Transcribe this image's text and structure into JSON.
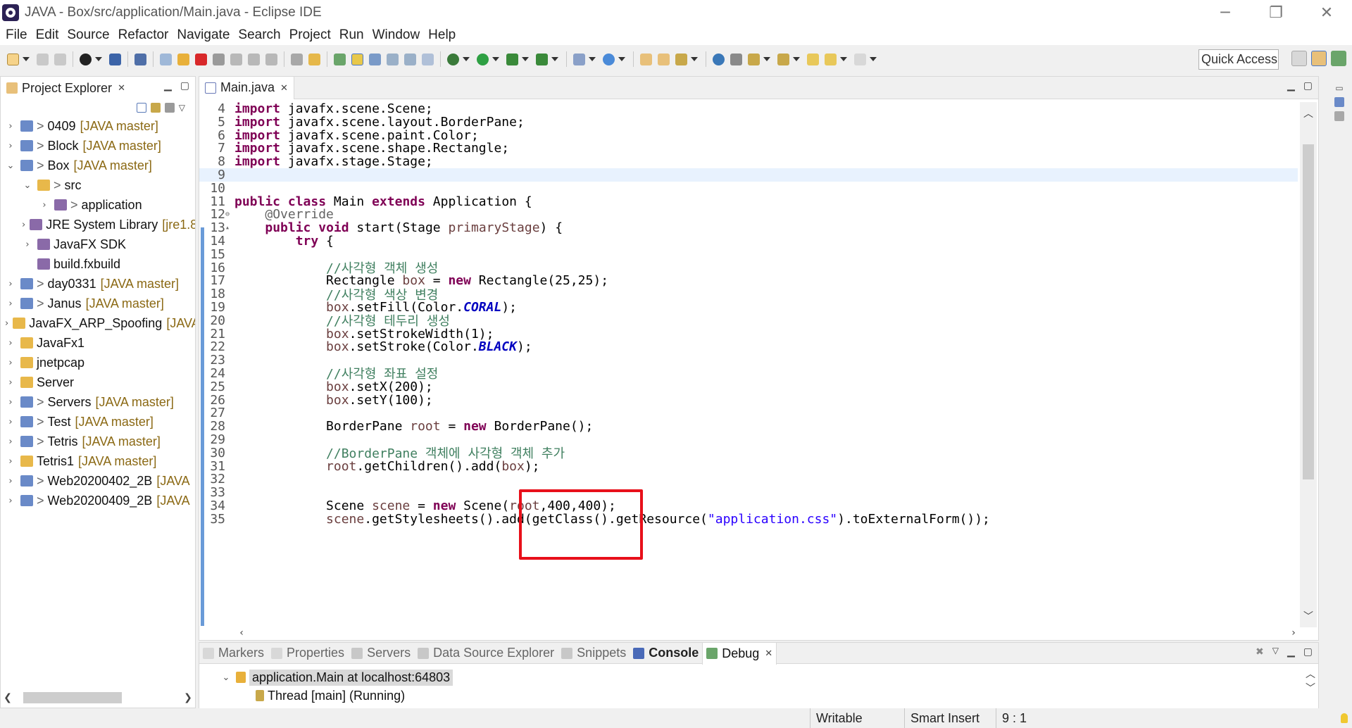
{
  "window": {
    "title": "JAVA - Box/src/application/Main.java - Eclipse IDE",
    "controls": [
      "─",
      "❐",
      "✕"
    ]
  },
  "menu": [
    "File",
    "Edit",
    "Source",
    "Refactor",
    "Navigate",
    "Search",
    "Project",
    "Run",
    "Window",
    "Help"
  ],
  "toolbar": {
    "quick_access_placeholder": "Quick Access"
  },
  "project_explorer": {
    "title": "Project Explorer",
    "items": [
      {
        "label": "0409",
        "deco": "[JAVA master]",
        "prefix": ">",
        "twisty": "›",
        "level": 0
      },
      {
        "label": "Block",
        "deco": "[JAVA master]",
        "prefix": ">",
        "twisty": "›",
        "level": 0
      },
      {
        "label": "Box",
        "deco": "[JAVA master]",
        "prefix": ">",
        "twisty": "⌄",
        "level": 0
      },
      {
        "label": "src",
        "deco": "",
        "prefix": ">",
        "twisty": "⌄",
        "level": 1
      },
      {
        "label": "application",
        "deco": "",
        "prefix": ">",
        "twisty": "›",
        "level": 2
      },
      {
        "label": "JRE System Library",
        "deco": "[jre1.8",
        "prefix": "",
        "twisty": "›",
        "level": 1
      },
      {
        "label": "JavaFX SDK",
        "deco": "",
        "prefix": "",
        "twisty": "›",
        "level": 1
      },
      {
        "label": "build.fxbuild",
        "deco": "",
        "prefix": "",
        "twisty": "",
        "level": 1
      },
      {
        "label": "day0331",
        "deco": "[JAVA master]",
        "prefix": ">",
        "twisty": "›",
        "level": 0
      },
      {
        "label": "Janus",
        "deco": "[JAVA master]",
        "prefix": ">",
        "twisty": "›",
        "level": 0
      },
      {
        "label": "JavaFX_ARP_Spoofing",
        "deco": "[JAVA",
        "prefix": "",
        "twisty": "›",
        "level": 0
      },
      {
        "label": "JavaFx1",
        "deco": "",
        "prefix": "",
        "twisty": "›",
        "level": 0
      },
      {
        "label": "jnetpcap",
        "deco": "",
        "prefix": "",
        "twisty": "›",
        "level": 0
      },
      {
        "label": "Server",
        "deco": "",
        "prefix": "",
        "twisty": "›",
        "level": 0
      },
      {
        "label": "Servers",
        "deco": "[JAVA master]",
        "prefix": ">",
        "twisty": "›",
        "level": 0
      },
      {
        "label": "Test",
        "deco": "[JAVA master]",
        "prefix": ">",
        "twisty": "›",
        "level": 0
      },
      {
        "label": "Tetris",
        "deco": "[JAVA master]",
        "prefix": ">",
        "twisty": "›",
        "level": 0
      },
      {
        "label": "Tetris1",
        "deco": "[JAVA master]",
        "prefix": "",
        "twisty": "›",
        "level": 0
      },
      {
        "label": "Web20200402_2B",
        "deco": "[JAVA",
        "prefix": ">",
        "twisty": "›",
        "level": 0
      },
      {
        "label": "Web20200409_2B",
        "deco": "[JAVA",
        "prefix": ">",
        "twisty": "›",
        "level": 0
      }
    ]
  },
  "editor": {
    "tab_label": "Main.java",
    "lines": [
      {
        "n": "4",
        "tokens": [
          [
            "kw",
            "import"
          ],
          [
            "",
            " javafx.scene.Scene;"
          ]
        ]
      },
      {
        "n": "5",
        "tokens": [
          [
            "kw",
            "import"
          ],
          [
            "",
            " javafx.scene.layout.BorderPane;"
          ]
        ]
      },
      {
        "n": "6",
        "tokens": [
          [
            "kw",
            "import"
          ],
          [
            "",
            " javafx.scene.paint.Color;"
          ]
        ]
      },
      {
        "n": "7",
        "tokens": [
          [
            "kw",
            "import"
          ],
          [
            "",
            " javafx.scene.shape.Rectangle;"
          ]
        ]
      },
      {
        "n": "8",
        "tokens": [
          [
            "kw",
            "import"
          ],
          [
            "",
            " javafx.stage.Stage;"
          ]
        ]
      },
      {
        "n": "9",
        "tokens": [],
        "current": true
      },
      {
        "n": "10",
        "tokens": []
      },
      {
        "n": "11",
        "tokens": [
          [
            "kw",
            "public"
          ],
          [
            "",
            " "
          ],
          [
            "kw",
            "class"
          ],
          [
            "",
            " Main "
          ],
          [
            "kw",
            "extends"
          ],
          [
            "",
            " Application {"
          ]
        ]
      },
      {
        "n": "12",
        "fold": "⊖",
        "tokens": [
          [
            "",
            "    "
          ],
          [
            "an",
            "@Override"
          ]
        ]
      },
      {
        "n": "13",
        "fold": "▴",
        "tokens": [
          [
            "",
            "    "
          ],
          [
            "kw",
            "public"
          ],
          [
            "",
            " "
          ],
          [
            "kw",
            "void"
          ],
          [
            "",
            " start(Stage "
          ],
          [
            "var",
            "primaryStage"
          ],
          [
            "",
            ") {"
          ]
        ]
      },
      {
        "n": "14",
        "tokens": [
          [
            "",
            "        "
          ],
          [
            "kw",
            "try"
          ],
          [
            "",
            " {"
          ]
        ]
      },
      {
        "n": "15",
        "tokens": []
      },
      {
        "n": "16",
        "tokens": [
          [
            "",
            "            "
          ],
          [
            "cm",
            "//사각형 객체 생성"
          ]
        ]
      },
      {
        "n": "17",
        "tokens": [
          [
            "",
            "            Rectangle "
          ],
          [
            "var",
            "box"
          ],
          [
            "",
            " = "
          ],
          [
            "kw",
            "new"
          ],
          [
            "",
            " Rectangle(25,25);"
          ]
        ]
      },
      {
        "n": "18",
        "tokens": [
          [
            "",
            "            "
          ],
          [
            "cm",
            "//사각형 색상 변경"
          ]
        ]
      },
      {
        "n": "19",
        "tokens": [
          [
            "",
            "            "
          ],
          [
            "var",
            "box"
          ],
          [
            "",
            ".setFill(Color."
          ],
          [
            "fld",
            "CORAL"
          ],
          [
            "",
            ");"
          ]
        ]
      },
      {
        "n": "20",
        "tokens": [
          [
            "",
            "            "
          ],
          [
            "cm",
            "//사각형 테두리 생성"
          ]
        ]
      },
      {
        "n": "21",
        "tokens": [
          [
            "",
            "            "
          ],
          [
            "var",
            "box"
          ],
          [
            "",
            ".setStrokeWidth(1);"
          ]
        ]
      },
      {
        "n": "22",
        "tokens": [
          [
            "",
            "            "
          ],
          [
            "var",
            "box"
          ],
          [
            "",
            ".setStroke(Color."
          ],
          [
            "fld",
            "BLACK"
          ],
          [
            "",
            ");"
          ]
        ]
      },
      {
        "n": "23",
        "tokens": []
      },
      {
        "n": "24",
        "tokens": [
          [
            "",
            "            "
          ],
          [
            "cm",
            "//사각형 좌표 설정"
          ]
        ]
      },
      {
        "n": "25",
        "tokens": [
          [
            "",
            "            "
          ],
          [
            "var",
            "box"
          ],
          [
            "",
            ".setX(200);"
          ]
        ]
      },
      {
        "n": "26",
        "tokens": [
          [
            "",
            "            "
          ],
          [
            "var",
            "box"
          ],
          [
            "",
            ".setY(100);"
          ]
        ]
      },
      {
        "n": "27",
        "tokens": []
      },
      {
        "n": "28",
        "tokens": [
          [
            "",
            "            BorderPane "
          ],
          [
            "var",
            "root"
          ],
          [
            "",
            " = "
          ],
          [
            "kw",
            "new"
          ],
          [
            "",
            " BorderPane();"
          ]
        ]
      },
      {
        "n": "29",
        "tokens": []
      },
      {
        "n": "30",
        "tokens": [
          [
            "",
            "            "
          ],
          [
            "cm",
            "//BorderPane 객체에 사각형 객체 추가"
          ]
        ]
      },
      {
        "n": "31",
        "tokens": [
          [
            "",
            "            "
          ],
          [
            "var",
            "root"
          ],
          [
            "",
            ".getChildren().add("
          ],
          [
            "var",
            "box"
          ],
          [
            "",
            ");"
          ]
        ]
      },
      {
        "n": "32",
        "tokens": []
      },
      {
        "n": "33",
        "tokens": []
      },
      {
        "n": "34",
        "tokens": [
          [
            "",
            "            Scene "
          ],
          [
            "var",
            "scene"
          ],
          [
            "",
            " = "
          ],
          [
            "kw",
            "new"
          ],
          [
            "",
            " Scene("
          ],
          [
            "var",
            "root"
          ],
          [
            "",
            ",400,400);"
          ]
        ]
      },
      {
        "n": "35",
        "tokens": [
          [
            "",
            "            "
          ],
          [
            "var",
            "scene"
          ],
          [
            "",
            ".getStylesheets().add(getClass().getResource("
          ],
          [
            "st",
            "\"application.css\""
          ],
          [
            "",
            ").toExternalForm());"
          ]
        ]
      }
    ]
  },
  "bottom_panel": {
    "tabs": [
      "Markers",
      "Properties",
      "Servers",
      "Data Source Explorer",
      "Snippets",
      "Console",
      "Debug"
    ],
    "active_tab": "Debug",
    "debug_app": "application.Main at localhost:64803",
    "debug_thread": "Thread [main] (Running)"
  },
  "status": {
    "mode": "Writable",
    "insert": "Smart Insert",
    "position": "9 : 1"
  },
  "colors": {
    "keyword": "#7f0055",
    "comment": "#3f7f5f",
    "string": "#2a00ff",
    "static_field": "#0000c0",
    "local_var": "#6a3e3e",
    "highlight_box": "#e8101a",
    "tree_decoration": "#8b6914"
  }
}
